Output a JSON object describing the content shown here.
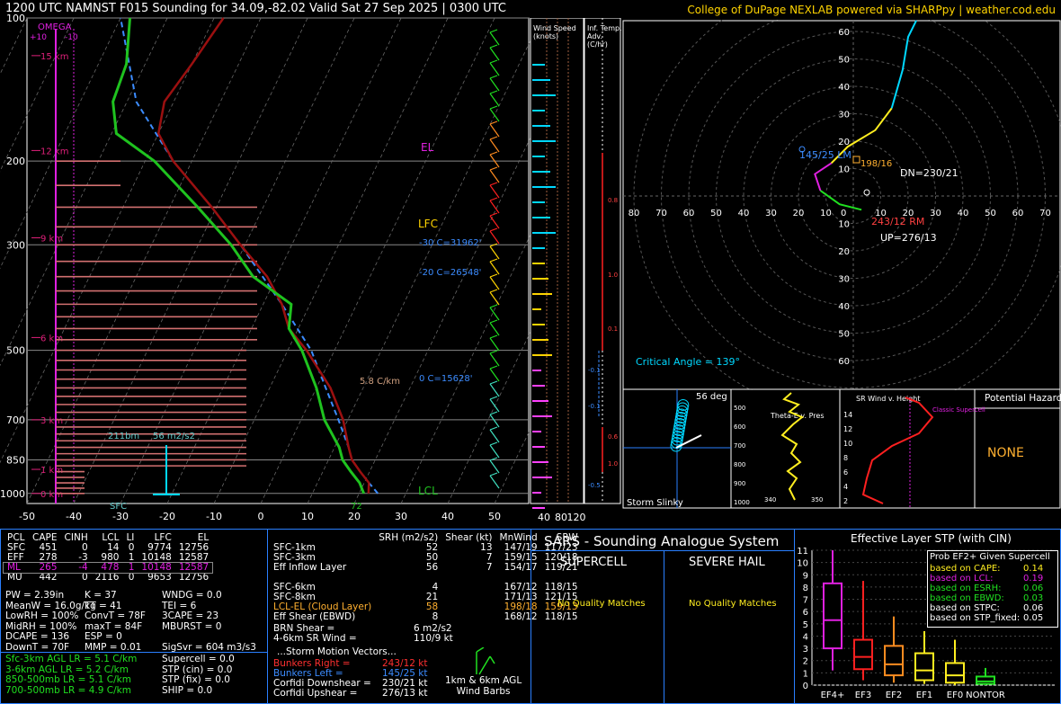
{
  "title": "1200 UTC NAMNST F015 Sounding for 34.09,-82.02 Valid  Sat 27 Sep 2025 | 0300 UTC",
  "credit": "College of DuPage NEXLAB powered via SHARPpy | weather.cod.edu",
  "colors": {
    "temp": "#c81414",
    "dew": "#1fc21f",
    "parcel": "#3c8cff",
    "wetbulb": "#00c8ff",
    "height": "#e0207a",
    "axis": "#ffffff",
    "panel_border": "#2a7fff"
  },
  "chart_data": [
    {
      "type": "line",
      "name": "skewt",
      "xlabel": "",
      "ylabel": "",
      "pressure_ticks": [
        "100",
        "200",
        "300",
        "500",
        "700",
        "850",
        "1000"
      ],
      "pressure_values": [
        100,
        200,
        300,
        500,
        700,
        850,
        1000
      ],
      "temp_ticks": [
        "-50",
        "-40",
        "-30",
        "-20",
        "-10",
        "0",
        "10",
        "20",
        "30",
        "40",
        "50"
      ],
      "temp_values": [
        -50,
        -40,
        -30,
        -20,
        -10,
        0,
        10,
        20,
        30,
        40,
        50
      ],
      "xlim": [
        -50,
        50
      ],
      "plim": [
        1050,
        100
      ],
      "height_labels": [
        "15 km",
        "12 km",
        "9 km",
        "6 km",
        "3 km",
        "1 km",
        "0 km"
      ],
      "height_pressures": [
        120,
        190,
        290,
        470,
        700,
        890,
        1000
      ],
      "omega_label": "OMEGA",
      "omega_ticks": [
        "+10",
        "-10"
      ],
      "temperature_profile": [
        [
          1000,
          22
        ],
        [
          950,
          21
        ],
        [
          900,
          18
        ],
        [
          850,
          15
        ],
        [
          800,
          13
        ],
        [
          700,
          9
        ],
        [
          600,
          3
        ],
        [
          500,
          -6
        ],
        [
          450,
          -12
        ],
        [
          400,
          -16
        ],
        [
          350,
          -22
        ],
        [
          300,
          -31
        ],
        [
          250,
          -41
        ],
        [
          200,
          -54
        ],
        [
          175,
          -60
        ],
        [
          150,
          -62
        ],
        [
          125,
          -60
        ],
        [
          100,
          -58
        ]
      ],
      "dewpoint_profile": [
        [
          1000,
          21
        ],
        [
          950,
          19
        ],
        [
          900,
          16
        ],
        [
          850,
          13
        ],
        [
          800,
          11
        ],
        [
          700,
          5
        ],
        [
          600,
          0
        ],
        [
          500,
          -7
        ],
        [
          450,
          -12
        ],
        [
          400,
          -14
        ],
        [
          350,
          -25
        ],
        [
          300,
          -33
        ],
        [
          250,
          -44
        ],
        [
          200,
          -58
        ],
        [
          175,
          -69
        ],
        [
          150,
          -73
        ],
        [
          125,
          -74
        ],
        [
          100,
          -78
        ]
      ],
      "parcel_profile": [
        [
          1000,
          24
        ],
        [
          950,
          21
        ],
        [
          900,
          18
        ],
        [
          850,
          15
        ],
        [
          800,
          13
        ],
        [
          700,
          8
        ],
        [
          600,
          2
        ],
        [
          500,
          -5
        ],
        [
          400,
          -16
        ],
        [
          300,
          -31
        ],
        [
          250,
          -41
        ],
        [
          200,
          -54
        ],
        [
          150,
          -68
        ],
        [
          100,
          -80
        ]
      ],
      "annotations": {
        "el": "EL",
        "lfc": "LFC",
        "lcl": "LCL",
        "iso30": "-30 C=31962'",
        "iso20": "-20 C=26548'",
        "frz": "0 C=15628'",
        "lapse": "5.8 C/km",
        "effl": "211bm",
        "srh_eff": "56 m2/s2",
        "sfc": "SFC",
        "sfc_td": "72"
      }
    },
    {
      "type": "line",
      "name": "hodograph",
      "xlabel": "",
      "ylabel": "",
      "rings": [
        "10",
        "20",
        "30",
        "40",
        "50",
        "60",
        "70",
        "80"
      ],
      "critical_angle": "Critical Angle = 139°",
      "rm_label": "243/12 RM",
      "lm_label": "145/25 LM",
      "dn_label": "DN=230/21",
      "up_label": "UP=276/13",
      "mw_label": "198/16",
      "hodo_points": [
        [
          3,
          -5
        ],
        [
          -5,
          -3
        ],
        [
          -12,
          2
        ],
        [
          -14,
          8
        ],
        [
          -8,
          12
        ],
        [
          -2,
          18
        ],
        [
          8,
          24
        ],
        [
          14,
          32
        ],
        [
          18,
          46
        ],
        [
          20,
          58
        ],
        [
          23,
          64
        ]
      ]
    },
    {
      "type": "bar",
      "name": "wind_speed",
      "title": "Wind Speed (knots)",
      "ticks": [
        "40",
        "80",
        "120"
      ]
    },
    {
      "type": "bar",
      "name": "inferred_temp_advection",
      "title": "Inf. Temp. Adv. (C/hr)",
      "values": [
        "0.8",
        "1.0",
        "0.1",
        "-0.1",
        "-0.1",
        "0.6",
        "1.0",
        "-0.5"
      ]
    },
    {
      "type": "line",
      "name": "storm_slinky",
      "title": "Storm Slinky",
      "angle": "56 deg"
    },
    {
      "type": "line",
      "name": "theta_e",
      "title": "Theta-E v. Pres",
      "yticks": [
        "500",
        "600",
        "700",
        "800",
        "900",
        "1000"
      ],
      "xticks": [
        "340",
        "350"
      ]
    },
    {
      "type": "line",
      "name": "srwind",
      "title": "SR Wind v. Height",
      "label": "Classic Supercell",
      "yticks": [
        "14",
        "12",
        "10",
        "8",
        "6",
        "4",
        "2"
      ]
    },
    {
      "type": "bar",
      "name": "stp_box",
      "title": "Effective Layer STP (with CIN)",
      "categories": [
        "EF4+",
        "EF3",
        "EF2",
        "EF1",
        "EF0",
        "NONTOR"
      ],
      "yticks": [
        "11",
        "10",
        "9",
        "8",
        "7",
        "6",
        "5",
        "4",
        "3",
        "2",
        "1",
        "0"
      ],
      "boxes": [
        {
          "name": "EF4+",
          "min": 1.2,
          "q1": 3.0,
          "med": 5.3,
          "q3": 8.3,
          "max": 11.0,
          "color": "#e020e0"
        },
        {
          "name": "EF3",
          "min": 0.4,
          "q1": 1.3,
          "med": 2.3,
          "q3": 3.7,
          "max": 8.5,
          "color": "#ff2020"
        },
        {
          "name": "EF2",
          "min": 0.2,
          "q1": 0.8,
          "med": 1.7,
          "q3": 3.2,
          "max": 5.6,
          "color": "#ff8c20"
        },
        {
          "name": "EF1",
          "min": 0.1,
          "q1": 0.4,
          "med": 1.2,
          "q3": 2.6,
          "max": 4.4,
          "color": "#ffee20"
        },
        {
          "name": "EF0",
          "min": 0.0,
          "q1": 0.2,
          "med": 0.8,
          "q3": 1.8,
          "max": 3.7,
          "color": "#ffee20"
        },
        {
          "name": "NONTOR",
          "min": 0.0,
          "q1": 0.1,
          "med": 0.3,
          "q3": 0.7,
          "max": 1.4,
          "color": "#20e020"
        }
      ]
    }
  ],
  "parcel_table": {
    "headers": [
      "PCL",
      "CAPE",
      "CINH",
      "LCL",
      "LI",
      "LFC",
      "EL"
    ],
    "rows": [
      [
        "SFC",
        "451",
        "0",
        "14",
        "0",
        "9774",
        "12756"
      ],
      [
        "EFF",
        "278",
        "-3",
        "980",
        "1",
        "10148",
        "12587"
      ],
      [
        "ML",
        "265",
        "-4",
        "478",
        "1",
        "10148",
        "12587"
      ],
      [
        "MU",
        "442",
        "0",
        "2116",
        "0",
        "9653",
        "12756"
      ]
    ]
  },
  "indices": {
    "col1": "PW = 2.39in\nMeanW = 16.0g/kg\nLowRH = 100%\nMidRH = 100%\nDCAPE = 136\nDownT = 70F",
    "col2": "K = 37\nTT = 41\nConvT = 78F\nmaxT = 84F\nESP = 0\nMMP = 0.01",
    "col3": "WNDG = 0.0\nTEI = 6\n3CAPE = 23\nMBURST = 0\n\nSigSvr = 604 m3/s3"
  },
  "lapse_rates": [
    "Sfc-3km AGL LR = 5.1 C/km",
    "3-6km AGL LR = 5.2 C/km",
    "850-500mb LR = 5.1 C/km",
    "700-500mb LR = 4.9 C/km"
  ],
  "composites": "Supercell = 0.0\nSTP (cin) = 0.0\nSTP (fix) = 0.0\nSHIP = 0.0",
  "kinematics": {
    "headers": [
      "SRH (m2/s2)",
      "Shear (kt)",
      "MnWind",
      "SRW"
    ],
    "rows": [
      [
        "SFC-1km",
        "52",
        "13",
        "147/19",
        "117/23"
      ],
      [
        "SFC-3km",
        "50",
        "7",
        "159/15",
        "120/18"
      ],
      [
        "Eff Inflow Layer",
        "56",
        "7",
        "154/17",
        "119/21"
      ],
      [
        "",
        "",
        "",
        "",
        ""
      ],
      [
        "SFC-6km",
        "4",
        "",
        "167/12",
        "118/15"
      ],
      [
        "SFC-8km",
        "21",
        "",
        "171/13",
        "121/15"
      ],
      [
        "LCL-EL (Cloud Layer)",
        "58",
        "",
        "198/18",
        "159/13"
      ],
      [
        "Eff Shear (EBWD)",
        "8",
        "",
        "168/12",
        "118/15"
      ]
    ],
    "brn_shear": "BRN Shear =",
    "brn_val": "6 m2/s2",
    "wind46": "4-6km SR Wind =",
    "wind46_val": "110/9 kt",
    "storm_vectors": "...Storm Motion Vectors...",
    "vectors": [
      [
        "Bunkers Right =",
        "243/12 kt",
        "#ff3030"
      ],
      [
        "Bunkers Left =",
        "145/25 kt",
        "#3c8cff"
      ],
      [
        "Corfidi Downshear =",
        "230/21 kt",
        "#ffffff"
      ],
      [
        "Corfidi Upshear =",
        "276/13 kt",
        "#ffffff"
      ]
    ],
    "barb_caption": "1km & 6km AGL\nWind Barbs"
  },
  "sars": {
    "title": "SARS - Sounding Analogue System",
    "supercell": "SUPERCELL",
    "hail": "SEVERE HAIL",
    "no_match1": "No Quality Matches",
    "no_match2": "No Quality Matches"
  },
  "stp_prob": {
    "title": "Prob EF2+ Given Supercell",
    "rows": [
      [
        "based on CAPE:",
        "0.14",
        "#ffee20"
      ],
      [
        "based on LCL:",
        "0.19",
        "#e020e0"
      ],
      [
        "based on ESRH:",
        "0.06",
        "#20e020"
      ],
      [
        "based on EBWD:",
        "0.03",
        "#20e020"
      ],
      [
        "based on STPC:",
        "0.06",
        "#ffffff"
      ],
      [
        "based on STP_fixed:",
        "0.05",
        "#ffffff"
      ]
    ]
  },
  "hazard": {
    "title": "Potential Hazard Type",
    "value": "NONE"
  }
}
